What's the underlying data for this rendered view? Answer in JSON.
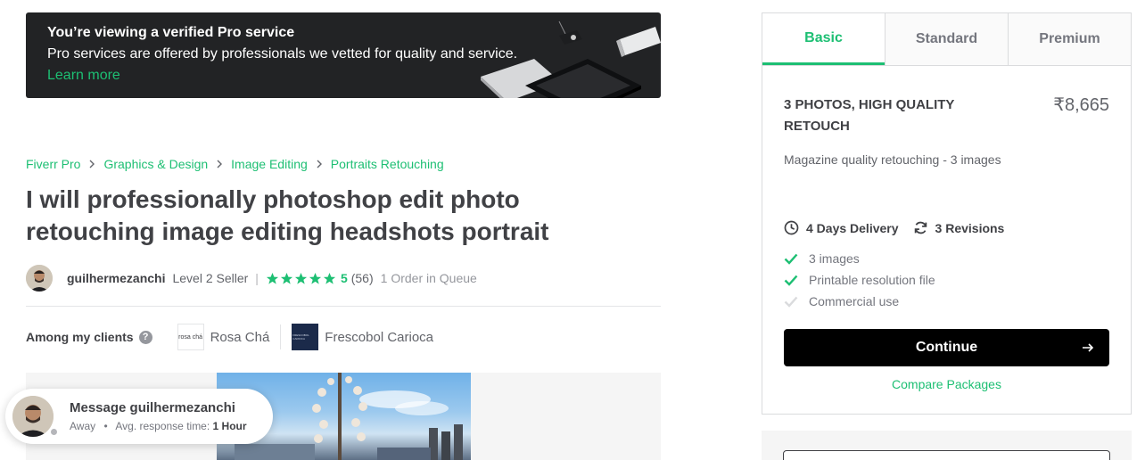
{
  "banner": {
    "title": "You’re viewing a verified Pro service",
    "text": "Pro services are offered by professionals we vetted for quality and service.",
    "link": "Learn more"
  },
  "breadcrumb": [
    "Fiverr Pro",
    "Graphics & Design",
    "Image Editing",
    "Portraits Retouching"
  ],
  "gig": {
    "title": "I will professionally photoshop edit photo retouching image editing headshots portrait"
  },
  "seller": {
    "name": "guilhermezanchi",
    "level": "Level 2 Seller",
    "separator": "|",
    "rating": "5",
    "rating_value": 5,
    "reviews": "(56)",
    "queue": "1 Order in Queue"
  },
  "clients": {
    "label": "Among my clients",
    "help_icon": "question-circle-icon",
    "help_glyph": "?",
    "items": [
      {
        "logo_text": "rosa chá",
        "name": "Rosa Chá"
      },
      {
        "logo_text": "FRESCOBOL CARIOCA",
        "name": "Frescobol Carioca"
      }
    ]
  },
  "message": {
    "title": "Message guilhermezanchi",
    "status": "Away",
    "dot": "•",
    "response_label": "Avg. response time:",
    "response_time": "1 Hour"
  },
  "packages": {
    "tabs": [
      "Basic",
      "Standard",
      "Premium"
    ],
    "active_tab": "Basic",
    "title": "3 PHOTOS, HIGH QUALITY RETOUCH",
    "price": "₹8,665",
    "description": "Magazine quality retouching - 3 images",
    "delivery": "4 Days Delivery",
    "revisions": "3 Revisions",
    "features": [
      {
        "label": "3 images",
        "included": true
      },
      {
        "label": "Printable resolution file",
        "included": true
      },
      {
        "label": "Commercial use",
        "included": false
      }
    ],
    "continue_label": "Continue",
    "compare_label": "Compare Packages"
  },
  "colors": {
    "accent": "#1dbf73",
    "banner_bg": "#222325",
    "text": "#404145",
    "muted": "#74767e"
  }
}
